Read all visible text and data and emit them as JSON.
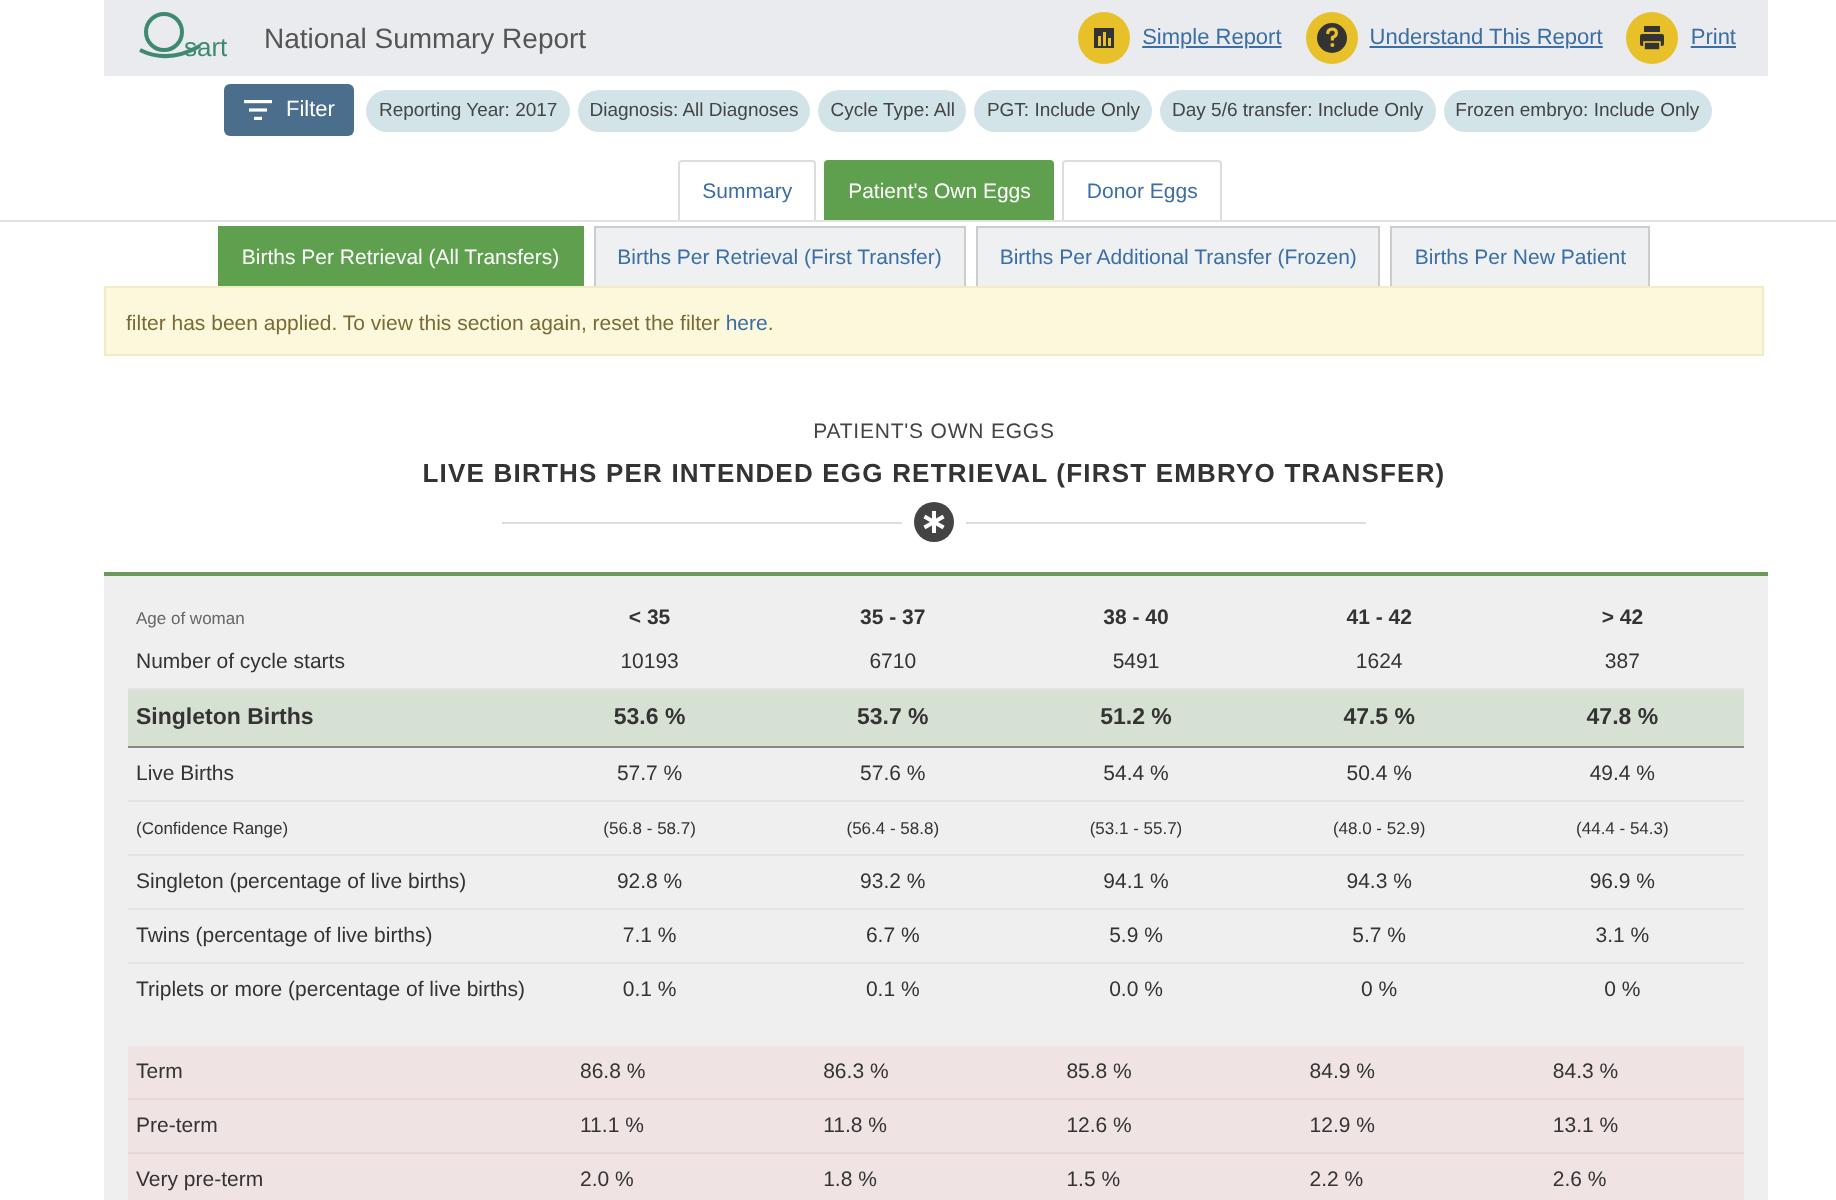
{
  "header": {
    "logo_text": "sart",
    "title": "National Summary Report",
    "links": [
      {
        "kind": "chart",
        "label": "Simple Report"
      },
      {
        "kind": "help",
        "label": "Understand This Report"
      },
      {
        "kind": "print",
        "label": "Print"
      }
    ]
  },
  "filter_bar": {
    "button": "Filter",
    "chips": [
      "Reporting Year: 2017",
      "Diagnosis: All Diagnoses",
      "Cycle Type: All",
      "PGT: Include Only",
      "Day 5/6 transfer: Include Only",
      "Frozen embryo: Include Only"
    ]
  },
  "tabs": [
    {
      "label": "Summary",
      "selected": false
    },
    {
      "label": "Patient's Own Eggs",
      "selected": true
    },
    {
      "label": "Donor Eggs",
      "selected": false
    }
  ],
  "subtabs": [
    {
      "label": "Births Per Retrieval (All Transfers)",
      "selected": true
    },
    {
      "label": "Births Per Retrieval (First Transfer)",
      "selected": false
    },
    {
      "label": "Births Per Additional Transfer (Frozen)",
      "selected": false
    },
    {
      "label": "Births Per New Patient",
      "selected": false
    }
  ],
  "notice": {
    "text": "filter has been applied. To view this section again, reset the filter ",
    "link": "here",
    "end": "."
  },
  "section": {
    "overline": "PATIENT'S OWN EGGS",
    "title": "LIVE BIRTHS PER INTENDED EGG RETRIEVAL (FIRST EMBRYO TRANSFER)"
  },
  "table": {
    "columns": [
      "Age of woman",
      "< 35",
      "35 - 37",
      "38 - 40",
      "41 - 42",
      "> 42"
    ],
    "rows": [
      {
        "kind": "plain",
        "label": "Number of cycle starts",
        "values": [
          "10193",
          "6710",
          "5491",
          "1624",
          "387"
        ]
      },
      {
        "kind": "highlight",
        "label": "Singleton Births",
        "values": [
          "53.6 %",
          "53.7 %",
          "51.2 %",
          "47.5 %",
          "47.8 %"
        ]
      },
      {
        "kind": "plain",
        "label": "Live Births",
        "values": [
          "57.7 %",
          "57.6 %",
          "54.4 %",
          "50.4 %",
          "49.4 %"
        ]
      },
      {
        "kind": "small",
        "label": "(Confidence Range)",
        "values": [
          "(56.8 - 58.7)",
          "(56.4 - 58.8)",
          "(53.1 - 55.7)",
          "(48.0 - 52.9)",
          "(44.4 - 54.3)"
        ]
      },
      {
        "kind": "plain",
        "label": "Singleton (percentage of live births)",
        "values": [
          "92.8 %",
          "93.2 %",
          "94.1 %",
          "94.3 %",
          "96.9 %"
        ]
      },
      {
        "kind": "plain",
        "label": "Twins (percentage of live births)",
        "values": [
          "7.1 %",
          "6.7 %",
          "5.9 %",
          "5.7 %",
          "3.1 %"
        ]
      },
      {
        "kind": "last",
        "label": "Triplets or more (percentage of live births)",
        "values": [
          "0.1 %",
          "0.1 %",
          "0.0 %",
          "0 %",
          "0 %"
        ]
      },
      {
        "kind": "term",
        "label": "Term",
        "values": [
          "86.8 %",
          "86.3 %",
          "85.8 %",
          "84.9 %",
          "84.3 %"
        ]
      },
      {
        "kind": "term",
        "label": "Pre-term",
        "values": [
          "11.1 %",
          "11.8 %",
          "12.6 %",
          "12.9 %",
          "13.1 %"
        ]
      },
      {
        "kind": "term",
        "label": "Very pre-term",
        "values": [
          "2.0 %",
          "1.8 %",
          "1.5 %",
          "2.2 %",
          "2.6 %"
        ]
      }
    ]
  }
}
